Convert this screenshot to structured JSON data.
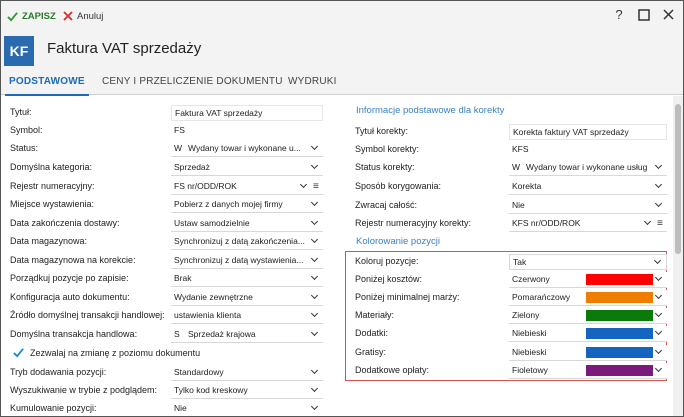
{
  "toolbar": {
    "save_label": "ZAPISZ",
    "cancel_label": "Anuluj"
  },
  "window": {
    "help": "?",
    "maximize": "☐",
    "close": "✕"
  },
  "header": {
    "logo": "KF",
    "title": "Faktura VAT sprzedaży"
  },
  "tabs": [
    "PODSTAWOWE",
    "CENY I PRZELICZENIE DOKUMENTU",
    "WYDRUKI"
  ],
  "left": {
    "rows": [
      {
        "label": "Tytuł:",
        "value": "Faktura VAT sprzedaży",
        "type": "text"
      },
      {
        "label": "Symbol:",
        "value": "FS",
        "type": "readonly"
      },
      {
        "label": "Status:",
        "prefix": "W",
        "value": "Wydany towar i wykonane u...",
        "type": "select"
      },
      {
        "label": "Domyślna kategoria:",
        "value": "Sprzedaż",
        "type": "select"
      },
      {
        "label": "Rejestr numeracyjny:",
        "value": "FS nr/ODD/ROK",
        "type": "select-menu"
      },
      {
        "label": "Miejsce wystawienia:",
        "value": "Pobierz z danych mojej firmy",
        "type": "select"
      },
      {
        "label": "Data zakończenia dostawy:",
        "value": "Ustaw samodzielnie",
        "type": "select"
      },
      {
        "label": "Data magazynowa:",
        "value": "Synchronizuj z datą zakończenia...",
        "type": "select"
      },
      {
        "label": "Data magazynowa na korekcie:",
        "value": "Synchronizuj z datą wystawienia...",
        "type": "select"
      },
      {
        "label": "Porządkuj pozycje po zapisie:",
        "value": "Brak",
        "type": "select"
      },
      {
        "label": "Konfiguracja auto dokumentu:",
        "value": "Wydanie zewnętrzne",
        "type": "select"
      },
      {
        "label": "Źródło domyślnej transakcji handlowej:",
        "value": "ustawienia klienta",
        "type": "select"
      },
      {
        "label": "Domyślna transakcja handlowa:",
        "prefix": "S",
        "value": "Sprzedaż krajowa",
        "type": "select"
      }
    ],
    "checkbox_label": "Zezwalaj na zmianę z poziomu dokumentu",
    "rows2": [
      {
        "label": "Tryb dodawania pozycji:",
        "value": "Standardowy",
        "type": "select"
      },
      {
        "label": "Wyszukiwanie w trybie z podglądem:",
        "value": "Tylko kod kreskowy",
        "type": "select"
      },
      {
        "label": "Kumulowanie pozycji:",
        "value": "Nie",
        "type": "select"
      }
    ]
  },
  "right": {
    "section1_title": "Informacje podstawowe dla korekty",
    "rows": [
      {
        "label": "Tytuł korekty:",
        "value": "Korekta faktury VAT sprzedaży",
        "type": "text"
      },
      {
        "label": "Symbol korekty:",
        "value": "KFS",
        "type": "readonly"
      },
      {
        "label": "Status korekty:",
        "prefix": "W",
        "value": "Wydany towar i wykonane usług",
        "type": "select"
      },
      {
        "label": "Sposób korygowania:",
        "value": "Korekta",
        "type": "select"
      },
      {
        "label": "Zwracaj całość:",
        "value": "Nie",
        "type": "select"
      },
      {
        "label": "Rejestr numeracyjny korekty:",
        "value": "KFS nr/ODD/ROK",
        "type": "select-menu"
      }
    ],
    "section2_title": "Kolorowanie pozycji",
    "color_rows": [
      {
        "label": "Koloruj pozycje:",
        "value": "Tak",
        "color": ""
      },
      {
        "label": "Poniżej kosztów:",
        "value": "Czerwony",
        "color": "#ff0000"
      },
      {
        "label": "Poniżej minimalnej marży:",
        "value": "Pomarańczowy",
        "color": "#ee7d00"
      },
      {
        "label": "Materiały:",
        "value": "Zielony",
        "color": "#0a7a0a"
      },
      {
        "label": "Dodatki:",
        "value": "Niebieski",
        "color": "#1565c0"
      },
      {
        "label": "Gratisy:",
        "value": "Niebieski",
        "color": "#1565c0"
      },
      {
        "label": "Dodatkowe opłaty:",
        "value": "Fioletowy",
        "color": "#7b1a7b"
      }
    ]
  },
  "colors": {
    "accent": "#1d6ab8",
    "section": "#3b82c4",
    "highlight_border": "#d9534f",
    "save": "#2b7a2b",
    "cancel": "#d32f2f"
  }
}
